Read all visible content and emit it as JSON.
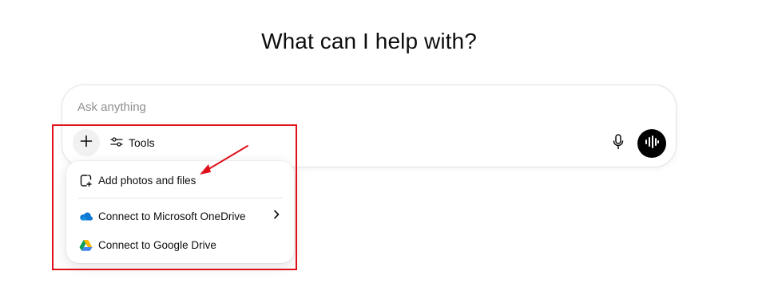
{
  "heading": "What can I help with?",
  "composer": {
    "placeholder": "Ask anything",
    "tools_label": "Tools"
  },
  "attach_menu": {
    "items": [
      {
        "label": "Add photos and files",
        "icon": "add-file-icon"
      },
      {
        "label": "Connect to Microsoft OneDrive",
        "icon": "onedrive-icon",
        "has_submenu": true
      },
      {
        "label": "Connect to Google Drive",
        "icon": "google-drive-icon"
      }
    ]
  },
  "colors": {
    "annotation": "#e0101a",
    "onedrive": "#0f78d4",
    "voice_button": "#000000"
  }
}
